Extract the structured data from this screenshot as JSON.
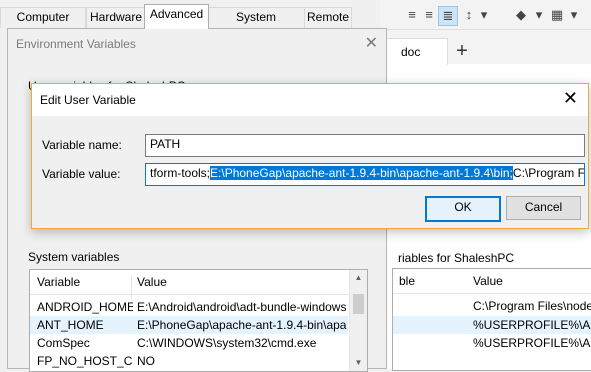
{
  "system_properties": {
    "tabs": [
      {
        "label": "Computer Name"
      },
      {
        "label": "Hardware"
      },
      {
        "label": "Advanced"
      },
      {
        "label": "System Protection"
      },
      {
        "label": "Remote"
      }
    ]
  },
  "background_app": {
    "doc_tab": "doc",
    "new_tab_icon": "plus-icon",
    "toolbar_icons": [
      "align-justify-icon",
      "line-spacing-icon",
      "fill-color-icon",
      "borders-icon"
    ]
  },
  "env_window": {
    "title": "Environment Variables",
    "user_vars_title_partial": "User variables for ShaleshPC",
    "system_vars_title": "System variables",
    "columns": {
      "variable": "Variable",
      "value": "Value"
    },
    "system_rows": [
      {
        "variable": "ANDROID_HOME",
        "value": "E:\\Android\\android\\adt-bundle-windows..."
      },
      {
        "variable": "ANT_HOME",
        "value": "E:\\PhoneGap\\apache-ant-1.9.4-bin\\apa..."
      },
      {
        "variable": "ComSpec",
        "value": "C:\\WINDOWS\\system32\\cmd.exe"
      },
      {
        "variable": "FP_NO_HOST_C...",
        "value": "NO"
      }
    ]
  },
  "right_user_vars": {
    "title": "riables for ShaleshPC",
    "col_variable": "ble",
    "col_value": "Value",
    "rows": [
      {
        "variable": "",
        "value": "C:\\Program Files\\nodejs\\"
      },
      {
        "variable": "",
        "value": "%USERPROFILE%\\AppD"
      },
      {
        "variable": "",
        "value": "%USERPROFILE%\\AppD"
      }
    ]
  },
  "dialog": {
    "title": "Edit User Variable",
    "name_label": "Variable name:",
    "name_value": "PATH",
    "value_label": "Variable value:",
    "value_before": "tform-tools;",
    "value_selected": "E:\\PhoneGap\\apache-ant-1.9.4-bin\\apache-ant-1.9.4\\bin;",
    "value_after": "C:\\Program Files\\J",
    "ok_label": "OK",
    "cancel_label": "Cancel"
  },
  "colors": {
    "accent": "#0078d7",
    "dialog_border": "#f1a73b"
  }
}
